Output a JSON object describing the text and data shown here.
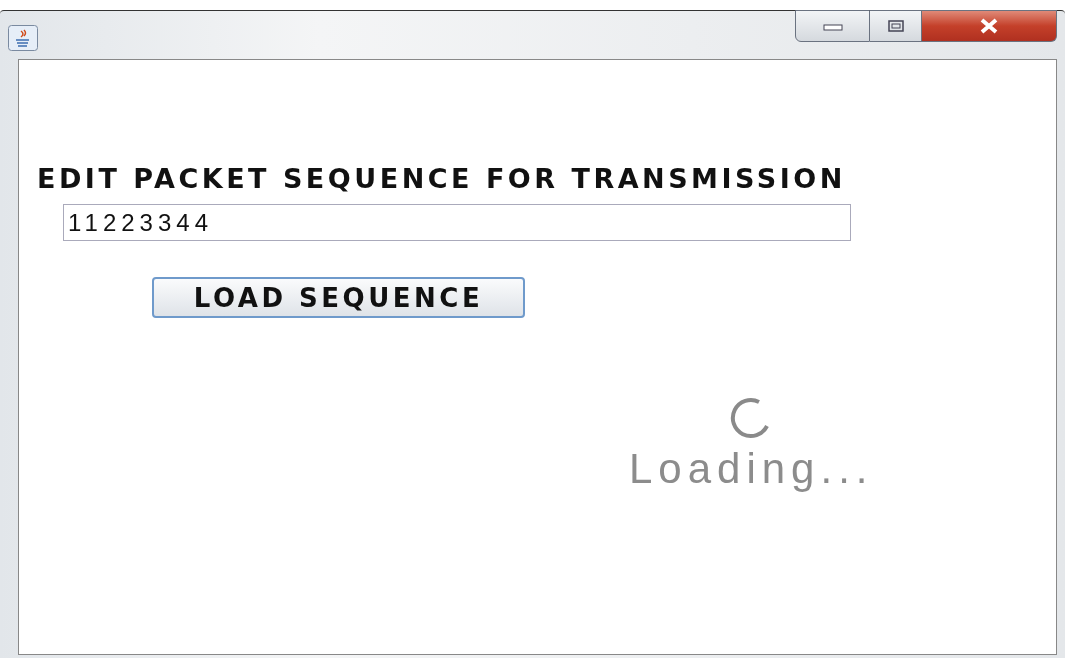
{
  "window": {
    "title_buttons": [
      {
        "kind": "minimize"
      },
      {
        "kind": "maximize"
      },
      {
        "kind": "close"
      }
    ]
  },
  "heading": "EDIT PACKET SEQUENCE FOR TRANSMISSION",
  "sequence_field": {
    "value": "11223344"
  },
  "load_button": {
    "label": "LOAD SEQUENCE"
  },
  "loading": {
    "label": "Loading..."
  }
}
